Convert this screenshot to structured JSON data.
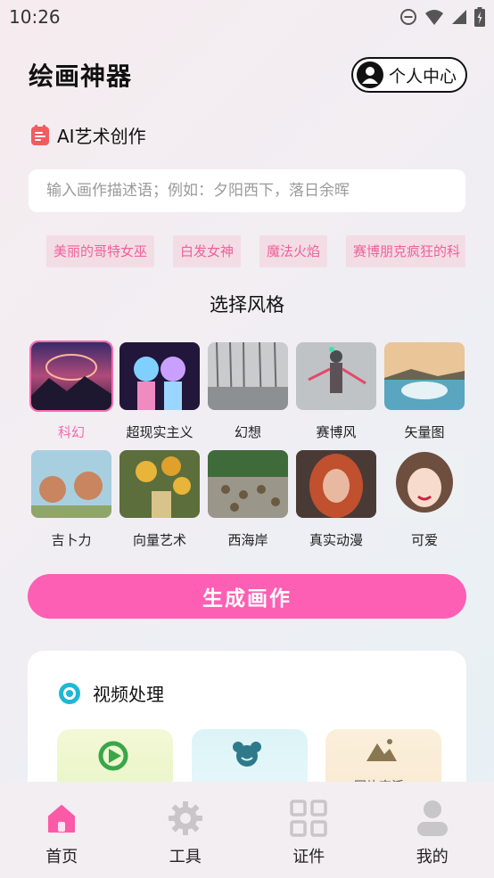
{
  "status": {
    "time": "10:26"
  },
  "header": {
    "title": "绘画神器",
    "profile_label": "个人中心"
  },
  "ai_section": {
    "label": "AI艺术创作"
  },
  "prompt": {
    "placeholder": "输入画作描述语；例如：夕阳西下，落日余晖",
    "value": ""
  },
  "tags": [
    "美丽的哥特女巫",
    "白发女神",
    "魔法火焰",
    "赛博朋克疯狂的科"
  ],
  "styles": {
    "title": "选择风格",
    "selected": "科幻",
    "items": [
      "科幻",
      "超现实主义",
      "幻想",
      "赛博风",
      "矢量图",
      "吉卜力",
      "向量艺术",
      "西海岸",
      "真实动漫",
      "可爱"
    ]
  },
  "generate": {
    "label": "生成画作"
  },
  "video": {
    "title": "视频处理",
    "tile3_label": "图片变活"
  },
  "nav": {
    "items": [
      "首页",
      "工具",
      "证件",
      "我的"
    ],
    "active": "首页"
  },
  "colors": {
    "accent": "#fd5fb4",
    "tag_text": "#f0609c",
    "tag_bg": "#f3dde4"
  }
}
